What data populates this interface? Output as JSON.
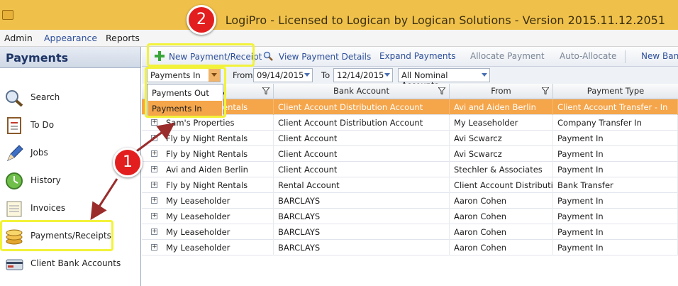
{
  "window": {
    "title": "LogiPro - Licensed to Logican by Logican Solutions - Version 2015.11.12.2051"
  },
  "menu": {
    "items": [
      "Admin",
      "Appearance",
      "Reports"
    ]
  },
  "sidebar": {
    "header": "Payments",
    "items": [
      {
        "label": "Search",
        "icon": "search-icon"
      },
      {
        "label": "To Do",
        "icon": "todo-icon"
      },
      {
        "label": "Jobs",
        "icon": "pencil-icon"
      },
      {
        "label": "History",
        "icon": "clock-icon"
      },
      {
        "label": "Invoices",
        "icon": "invoice-icon"
      },
      {
        "label": "Payments/Receipts",
        "icon": "coins-icon"
      },
      {
        "label": "Client Bank Accounts",
        "icon": "bank-card-icon"
      }
    ]
  },
  "toolbar": {
    "new_payment": "New Payment/Receipt",
    "view_details": "View Payment Details",
    "expand": "Expand Payments",
    "allocate": "Allocate Payment",
    "auto_allocate": "Auto-Allocate",
    "new_bank": "New Bank"
  },
  "filters": {
    "direction": "Payments In",
    "from_label": "From",
    "from_date": "09/14/2015",
    "to_label": "To",
    "to_date": "12/14/2015",
    "account": "All Nominal Accounts"
  },
  "dropdown": {
    "options": [
      "Payments Out",
      "Payments In"
    ],
    "selected": "Payments In"
  },
  "grid": {
    "columns": [
      "y",
      "Bank Account",
      "From",
      "Payment Type"
    ],
    "rows": [
      [
        "Fly by Night Rentals",
        "Client Account Distribution Account",
        "Avi and Aiden Berlin",
        "Client Account Transfer - In"
      ],
      [
        "Sam's Properties",
        "Client Account Distribution Account",
        "My Leaseholder",
        "Company Transfer In"
      ],
      [
        "Fly by Night Rentals",
        "Client Account",
        "Avi Scwarcz",
        "Payment In"
      ],
      [
        "Fly by Night Rentals",
        "Client Account",
        "Avi Scwarcz",
        "Payment In"
      ],
      [
        "Avi and Aiden Berlin",
        "Client Account",
        "Stechler & Associates",
        "Payment In"
      ],
      [
        "Fly by Night Rentals",
        "Rental Account",
        "Client Account Distributio",
        "Bank Transfer"
      ],
      [
        "My Leaseholder",
        "BARCLAYS",
        "Aaron Cohen",
        "Payment In"
      ],
      [
        "My Leaseholder",
        "BARCLAYS",
        "Aaron Cohen",
        "Payment In"
      ],
      [
        "My Leaseholder",
        "BARCLAYS",
        "Aaron Cohen",
        "Payment In"
      ],
      [
        "My Leaseholder",
        "BARCLAYS",
        "Aaron Cohen",
        "Payment In"
      ]
    ]
  },
  "callouts": {
    "one": "1",
    "two": "2"
  },
  "colors": {
    "titlebar": "#f0c14a",
    "selection": "#f5a54a",
    "highlight": "#f2f23a",
    "badge": "#e31e1e"
  }
}
